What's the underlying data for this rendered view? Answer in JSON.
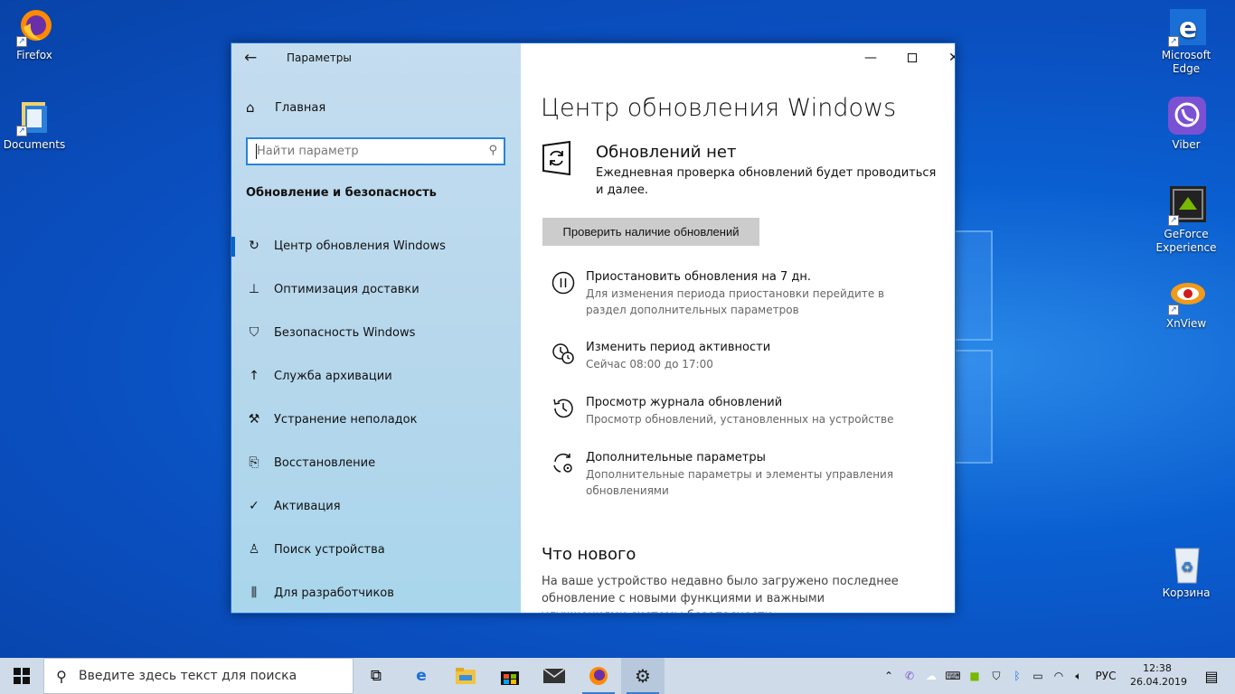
{
  "desktop": {
    "icons_left": [
      {
        "label": "Firefox",
        "icon": "firefox-icon"
      },
      {
        "label": "Documents",
        "icon": "folder-icon"
      }
    ],
    "icons_right": [
      {
        "label": "Microsoft Edge",
        "icon": "edge-icon"
      },
      {
        "label": "Viber",
        "icon": "viber-icon"
      },
      {
        "label": "GeForce Experience",
        "icon": "geforce-icon"
      },
      {
        "label": "XnView",
        "icon": "xnview-icon"
      },
      {
        "label": "Корзина",
        "icon": "recycle-bin-icon"
      }
    ]
  },
  "window": {
    "app_title": "Параметры",
    "sidebar": {
      "home_label": "Главная",
      "search_placeholder": "Найти параметр",
      "section_title": "Обновление и безопасность",
      "items": [
        {
          "label": "Центр обновления Windows",
          "icon": "sync-icon",
          "active": true
        },
        {
          "label": "Оптимизация доставки",
          "icon": "delivery-icon"
        },
        {
          "label": "Безопасность Windows",
          "icon": "shield-icon"
        },
        {
          "label": "Служба архивации",
          "icon": "backup-icon"
        },
        {
          "label": "Устранение неполадок",
          "icon": "wrench-icon"
        },
        {
          "label": "Восстановление",
          "icon": "recovery-icon"
        },
        {
          "label": "Активация",
          "icon": "check-circle-icon"
        },
        {
          "label": "Поиск устройства",
          "icon": "person-icon"
        },
        {
          "label": "Для разработчиков",
          "icon": "developer-icon"
        }
      ]
    },
    "content": {
      "page_title": "Центр обновления Windows",
      "status_title": "Обновлений нет",
      "status_subtitle": "Ежедневная проверка обновлений будет проводиться и далее.",
      "check_button": "Проверить наличие обновлений",
      "options": [
        {
          "title": "Приостановить обновления на 7 дн.",
          "subtitle": "Для изменения периода приостановки перейдите в раздел дополнительных параметров",
          "icon": "pause-icon"
        },
        {
          "title": "Изменить период активности",
          "subtitle": "Сейчас 08:00 до 17:00",
          "icon": "active-hours-icon"
        },
        {
          "title": "Просмотр журнала обновлений",
          "subtitle": "Просмотр обновлений, установленных на устройстве",
          "icon": "history-icon"
        },
        {
          "title": "Дополнительные параметры",
          "subtitle": "Дополнительные параметры и элементы управления обновлениями",
          "icon": "advanced-options-icon"
        }
      ],
      "whats_new_title": "Что нового",
      "whats_new_text": "На ваше устройство недавно было загружено последнее обновление с новыми функциями и важными улучшениями системы безопасности."
    }
  },
  "taskbar": {
    "search_placeholder": "Введите здесь текст для поиска",
    "language": "РУС",
    "time": "12:38",
    "date": "26.04.2019",
    "accent": "#0a63c9"
  }
}
